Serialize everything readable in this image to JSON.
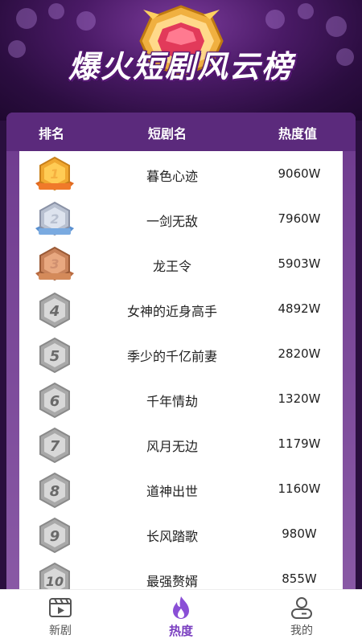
{
  "title": "爆火短剧风云榜",
  "table": {
    "col_rank": "排名",
    "col_name": "短剧名",
    "col_heat": "热度值",
    "rows": [
      {
        "rank": "1",
        "medal": "gold",
        "name": "暮色心迹",
        "heat": "9060W"
      },
      {
        "rank": "2",
        "medal": "silver",
        "name": "一剑无敌",
        "heat": "7960W"
      },
      {
        "rank": "3",
        "medal": "bronze",
        "name": "龙王令",
        "heat": "5903W"
      },
      {
        "rank": "4",
        "medal": "gray",
        "name": "女神的近身高手",
        "heat": "4892W"
      },
      {
        "rank": "5",
        "medal": "gray",
        "name": "季少的千亿前妻",
        "heat": "2820W"
      },
      {
        "rank": "6",
        "medal": "gray",
        "name": "千年情劫",
        "heat": "1320W"
      },
      {
        "rank": "7",
        "medal": "gray",
        "name": "风月无边",
        "heat": "1179W"
      },
      {
        "rank": "8",
        "medal": "gray",
        "name": "道神出世",
        "heat": "1160W"
      },
      {
        "rank": "9",
        "medal": "gray",
        "name": "长风踏歌",
        "heat": "980W"
      },
      {
        "rank": "10",
        "medal": "gray",
        "name": "最强赘婿",
        "heat": "855W"
      }
    ]
  },
  "tabs": [
    {
      "label": "新剧",
      "icon": "film-icon",
      "active": false
    },
    {
      "label": "热度",
      "icon": "flame-icon",
      "active": true
    },
    {
      "label": "我的",
      "icon": "user-icon",
      "active": false
    }
  ],
  "colors": {
    "accent": "#7a3fc0",
    "header": "#5b2a7c",
    "gold": "#f0a830",
    "silver": "#b8c0d0",
    "bronze": "#c8825a"
  }
}
